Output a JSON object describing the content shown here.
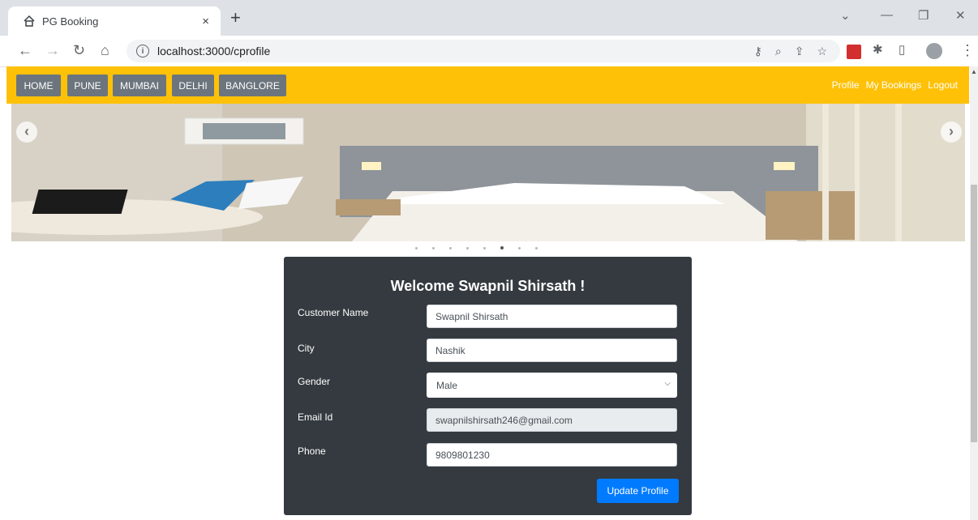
{
  "browser": {
    "tab_title": "PG Booking",
    "tab_close": "×",
    "new_tab": "+",
    "url": "localhost:3000/cprofile"
  },
  "navbar": {
    "city_buttons": [
      "HOME",
      "PUNE",
      "MUMBAI",
      "DELHI",
      "BANGLORE"
    ],
    "right_links": [
      "Profile",
      "My Bookings",
      "Logout"
    ],
    "accent_color": "#ffc107"
  },
  "carousel": {
    "indicator_count": 8,
    "active_index": 5
  },
  "profile": {
    "heading": "Welcome Swapnil Shirsath !",
    "fields": {
      "name_label": "Customer Name",
      "name_value": "Swapnil Shirsath",
      "city_label": "City",
      "city_value": "Nashik",
      "gender_label": "Gender",
      "gender_value": "Male",
      "email_label": "Email Id",
      "email_value": "swapnilshirsath246@gmail.com",
      "phone_label": "Phone",
      "phone_value": "9809801230"
    },
    "submit_label": "Update Profile",
    "submit_color": "#007bff"
  }
}
